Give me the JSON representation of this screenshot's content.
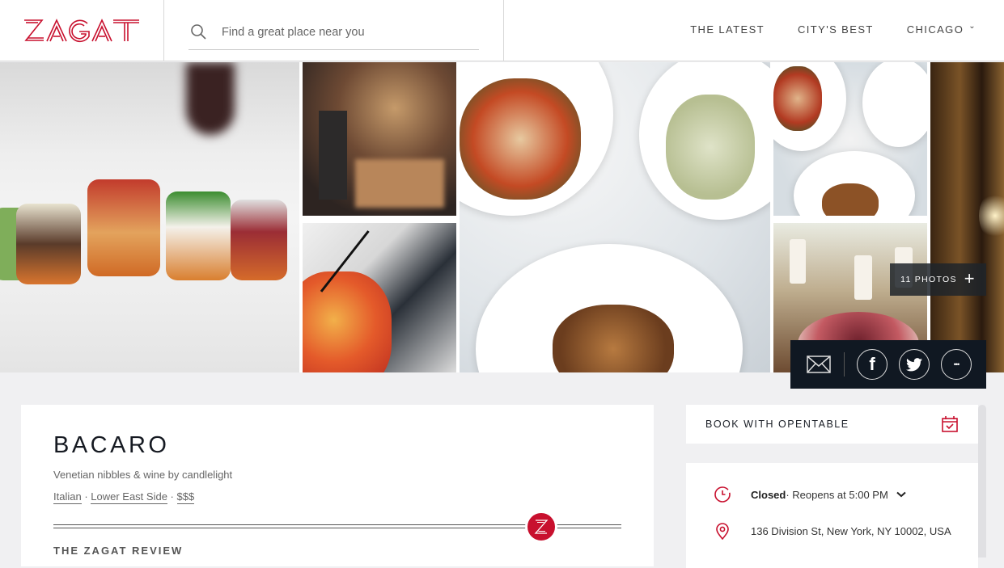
{
  "header": {
    "logo_text": "ZAGAT",
    "search_placeholder": "Find a great place near you",
    "nav": [
      {
        "label": "THE LATEST"
      },
      {
        "label": "CITY'S BEST"
      },
      {
        "label": "CHICAGO",
        "has_dropdown": true
      }
    ]
  },
  "gallery": {
    "photo_count_label": "11 PHOTOS",
    "photos": [
      {
        "alt": "Crostini platter"
      },
      {
        "alt": "Candlelit dining room"
      },
      {
        "alt": "Cocktail with orange twist"
      },
      {
        "alt": "Overhead plates of food"
      },
      {
        "alt": "Plates of food"
      },
      {
        "alt": "Candlelit table setting"
      },
      {
        "alt": "Restaurant entrance"
      }
    ]
  },
  "share": {
    "items": [
      {
        "icon": "mail-icon"
      },
      {
        "icon": "facebook-icon",
        "glyph": "f"
      },
      {
        "icon": "twitter-icon"
      },
      {
        "icon": "more-icon",
        "glyph": "•••"
      }
    ]
  },
  "restaurant": {
    "name": "BACARO",
    "tagline": "Venetian nibbles & wine by candlelight",
    "cuisine": "Italian",
    "neighborhood": "Lower East Side",
    "price": "$$$",
    "separator": " · ",
    "review_heading": "THE ZAGAT REVIEW"
  },
  "sidebar": {
    "book_label": "BOOK WITH OPENTABLE",
    "status_bold": "Closed",
    "status_rest": " · Reopens at 5:00 PM",
    "address": "136 Division St, New York, NY 10002, USA"
  },
  "colors": {
    "brand_red": "#c8102e",
    "dark_navy": "#101822",
    "page_bg": "#f0f0f2"
  }
}
